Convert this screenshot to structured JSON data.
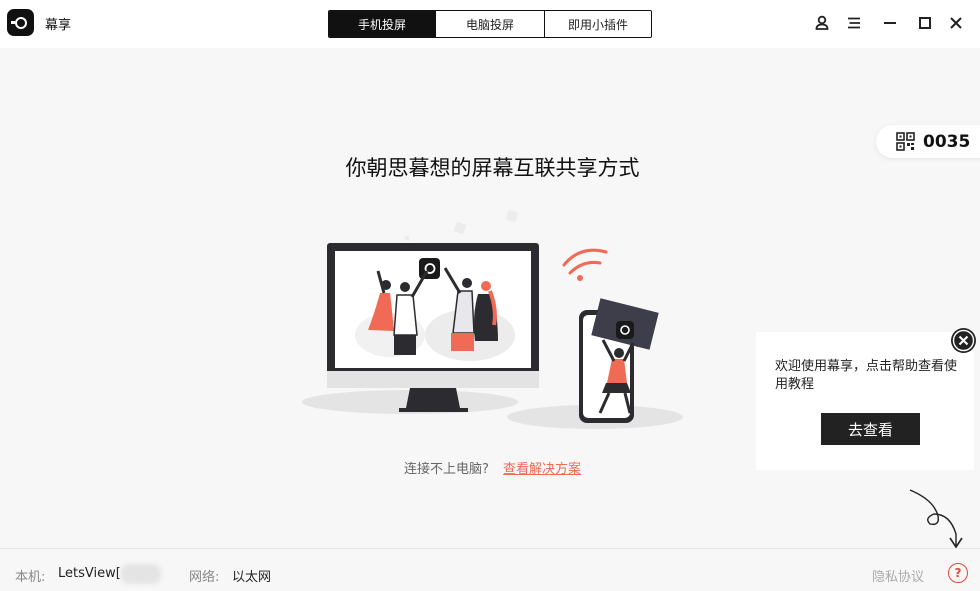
{
  "app": {
    "name": "幕享"
  },
  "tabs": [
    {
      "label": "手机投屏",
      "active": true
    },
    {
      "label": "电脑投屏",
      "active": false
    },
    {
      "label": "即用小插件",
      "active": false
    }
  ],
  "window_controls": [
    "user-icon",
    "menu-icon",
    "minimize-icon",
    "maximize-icon",
    "close-icon"
  ],
  "main": {
    "headline": "你朝思暮想的屏幕互联共享方式",
    "connection_code": "0035",
    "help_question": "连接不上电脑?",
    "help_link": "查看解决方案"
  },
  "popup": {
    "text": "欢迎使用幕享，点击帮助查看使用教程",
    "button": "去查看"
  },
  "status": {
    "device_label": "本机:",
    "device_value": "LetsView[",
    "network_label": "网络:",
    "network_value": "以太网",
    "privacy": "隐私协议",
    "help_icon": "?"
  },
  "colors": {
    "accent": "#f06a55",
    "dark": "#111111",
    "background": "#f7f7f7"
  }
}
